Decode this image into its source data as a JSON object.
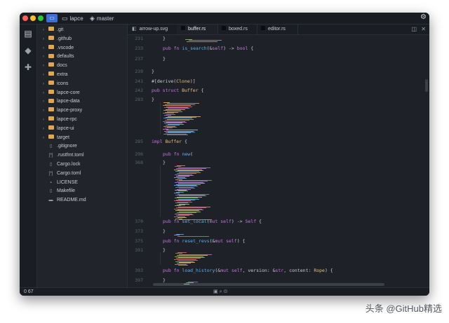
{
  "titlebar": {
    "folder_icon": "folder-icon",
    "project": "lapce",
    "branch_icon": "git-branch-icon",
    "branch": "master",
    "gear_icon": "gear-icon"
  },
  "activity_bar": {
    "icons": [
      "files-icon",
      "git-icon",
      "extensions-icon"
    ]
  },
  "sidebar": {
    "folders": [
      ".git",
      ".github",
      ".vscode",
      "defaults",
      "docs",
      "extra",
      "icons",
      "lapce-core",
      "lapce-data",
      "lapce-proxy",
      "lapce-rpc",
      "lapce-ui",
      "target"
    ],
    "files": [
      {
        "name": ".gitignore",
        "icon": "▯"
      },
      {
        "name": ".rustfmt.toml",
        "icon": "[*]"
      },
      {
        "name": "Cargo.lock",
        "icon": "▯"
      },
      {
        "name": "Cargo.toml",
        "icon": "[*]"
      },
      {
        "name": "LICENSE",
        "icon": "▪"
      },
      {
        "name": "Makefile",
        "icon": "▯"
      },
      {
        "name": "README.md",
        "icon": "▬"
      }
    ]
  },
  "tabs": [
    {
      "label": "arrow-up.svg",
      "active": false
    },
    {
      "label": "buffer.rs",
      "active": true
    },
    {
      "label": "boxed.rs",
      "active": false
    },
    {
      "label": "editor.rs",
      "active": false
    }
  ],
  "editor": {
    "lines": [
      {
        "no": "231",
        "indent": 2,
        "text": "}"
      },
      {
        "no": "233",
        "indent": 2,
        "text": "pub fn is_search(&self) -> bool {"
      },
      {
        "no": "237",
        "indent": 2,
        "text": "}"
      },
      {
        "no": "239",
        "indent": 1,
        "text": "}"
      },
      {
        "no": "241",
        "indent": 1,
        "text": "#[derive(Clone)]"
      },
      {
        "no": "242",
        "indent": 1,
        "text": "pub struct Buffer {"
      },
      {
        "no": "283",
        "indent": 1,
        "text": "}"
      },
      {
        "no": "285",
        "indent": 1,
        "text": "impl Buffer {"
      },
      {
        "no": "296",
        "indent": 2,
        "text": "pub fn new("
      },
      {
        "no": "368",
        "indent": 2,
        "text": "}"
      },
      {
        "no": "370",
        "indent": 2,
        "text": "pub fn set_local(mut self) -> Self {"
      },
      {
        "no": "373",
        "indent": 2,
        "text": "}"
      },
      {
        "no": "375",
        "indent": 2,
        "text": "pub fn reset_revs(&mut self) {"
      },
      {
        "no": "391",
        "indent": 2,
        "text": "}"
      },
      {
        "no": "393",
        "indent": 2,
        "text": "pub fn load_history(&mut self, version: &str, content: Rope) {"
      },
      {
        "no": "397",
        "indent": 2,
        "text": "}"
      }
    ]
  },
  "statusbar": {
    "text": "0 67"
  },
  "watermark": "头条 @GitHub精选"
}
